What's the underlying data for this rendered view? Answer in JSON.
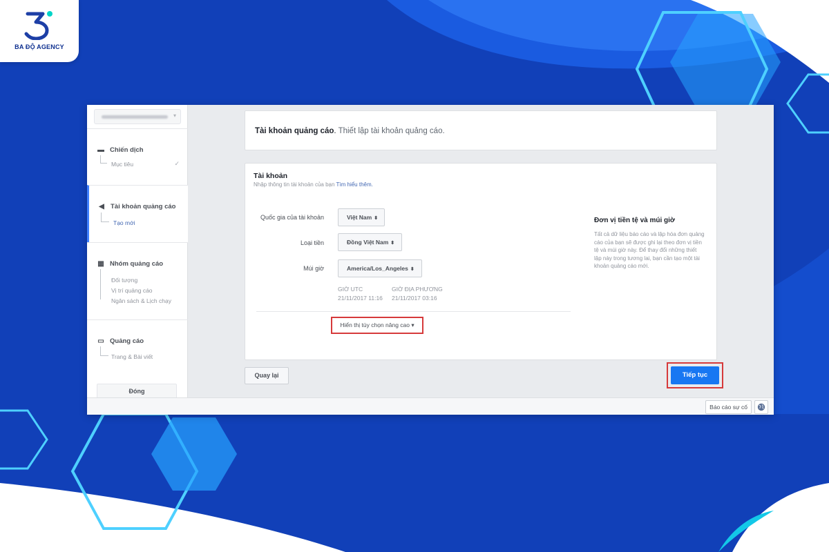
{
  "brand": {
    "name": "BA ĐỘ AGENCY",
    "logo_icon": "digit-3-logo",
    "accent": "#00d4c8"
  },
  "sidebar": {
    "account_selector": "blurred-account-name",
    "sections": [
      {
        "title": "Chiến dịch",
        "icon": "folder-icon",
        "items": [
          "Mục tiêu"
        ]
      },
      {
        "title": "Tài khoản quảng cáo",
        "icon": "megaphone-icon",
        "items": [
          "Tạo mới"
        ]
      },
      {
        "title": "Nhóm quảng cáo",
        "icon": "grid-icon",
        "items": [
          "Đối tượng",
          "Vị trí quảng cáo",
          "Ngân sách & Lịch chạy"
        ]
      },
      {
        "title": "Quảng cáo",
        "icon": "ad-icon",
        "items": [
          "Trang & Bài viết"
        ]
      }
    ],
    "close_label": "Đóng"
  },
  "header": {
    "title": "Tài khoản quảng cáo",
    "subtitle": "Thiết lập tài khoản quảng cáo."
  },
  "form": {
    "title": "Tài khoản",
    "description": "Nhập thông tin tài khoản của bạn",
    "learn_more": "Tìm hiểu thêm.",
    "fields": [
      {
        "label": "Quốc gia của tài khoản",
        "value": "Việt Nam"
      },
      {
        "label": "Loại tiền",
        "value": "Đồng Việt Nam"
      },
      {
        "label": "Múi giờ",
        "value": "America/Los_Angeles"
      }
    ],
    "timezone": {
      "utc_label": "GIỜ UTC",
      "utc_value": "21/11/2017 11:16",
      "local_label": "GIỜ ĐỊA PHƯƠNG",
      "local_value": "21/11/2017 03:16"
    },
    "advanced_label": "Hiển thị tùy chọn nâng cao"
  },
  "info": {
    "title": "Đơn vị tiền tệ và múi giờ",
    "text": "Tất cả dữ liệu báo cáo và lập hóa đơn quảng cáo của bạn sẽ được ghi lại theo đơn vị tiền tệ và múi giờ này. Để thay đổi những thiết lập này trong tương lai, bạn cần tạo một tài khoản quảng cáo mới."
  },
  "footer": {
    "back_label": "Quay lại",
    "next_label": "Tiếp tục",
    "report_label": "Báo cáo sự cố"
  },
  "colors": {
    "primary": "#1877f2",
    "highlight": "#d6393a",
    "background": "#1140b8"
  }
}
